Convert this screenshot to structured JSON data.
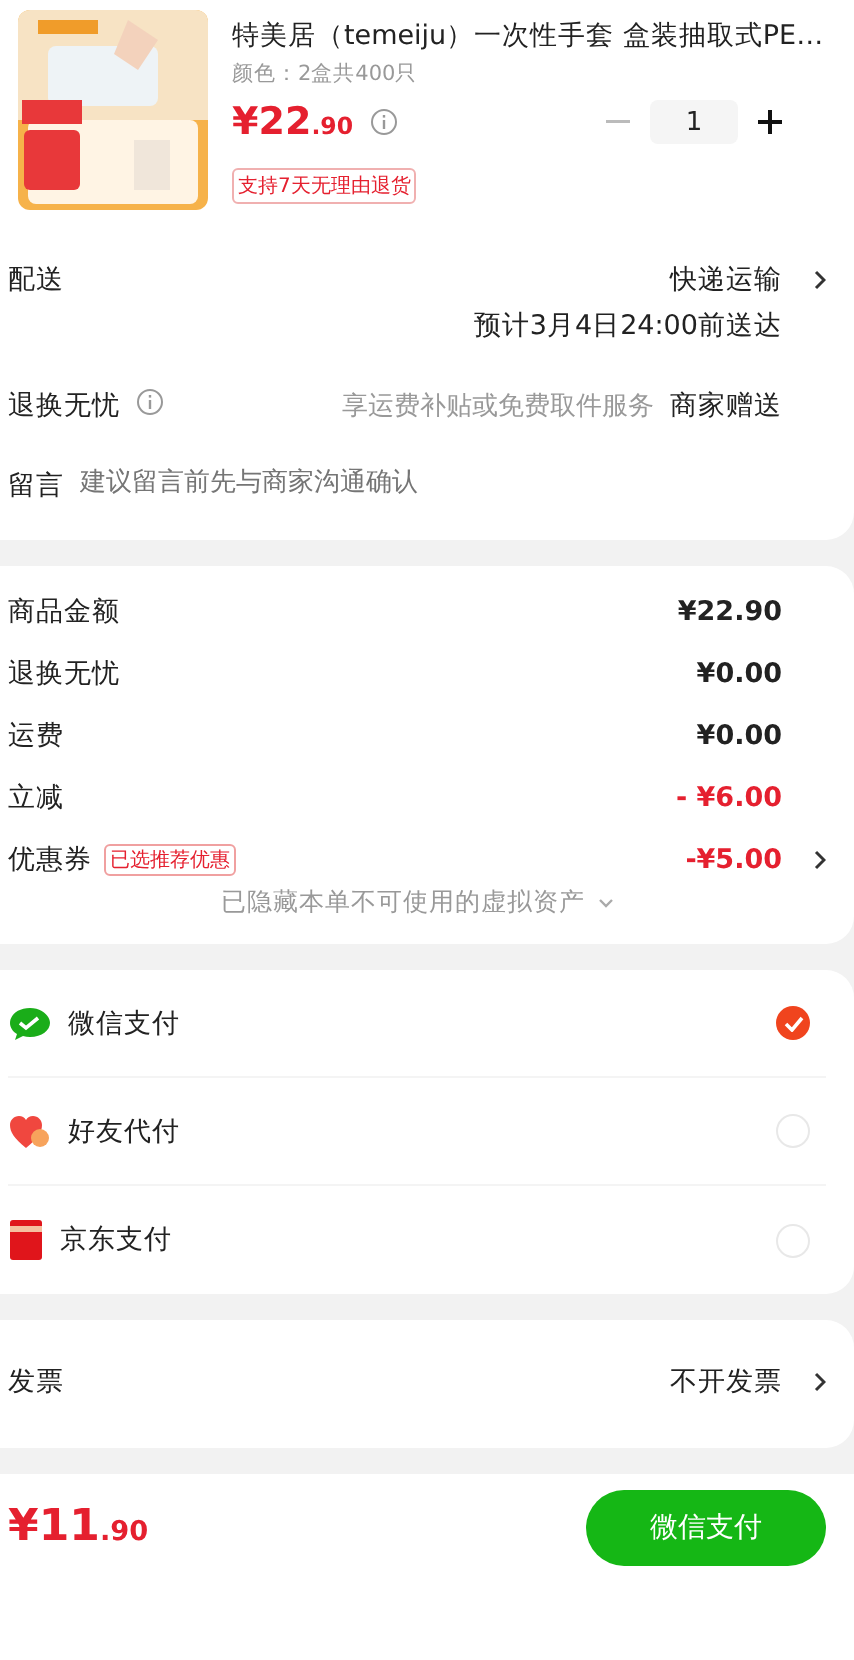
{
  "product": {
    "title": "特美居（temeiju）一次性手套 盒装抽取式PE…",
    "variant": "颜色：2盒共400只",
    "price": {
      "symbol": "¥",
      "integer": "22",
      "decimal": ".90"
    },
    "quantity": "1",
    "badge": "支持7天无理由退货"
  },
  "order_rows": [
    {
      "kind": "delivery",
      "label": "配送",
      "value": "快递运输",
      "note": "预计3月4日24:00前送达"
    },
    {
      "kind": "service",
      "label": "退换无忧",
      "hint": "享运费补贴或免费取件服务",
      "value": "商家赠送"
    },
    {
      "kind": "message",
      "label": "留言",
      "placeholder": "建议留言前先与商家沟通确认"
    }
  ],
  "summary": [
    {
      "label": "商品金额",
      "value": "¥22.90",
      "discount": false
    },
    {
      "label": "退换无忧",
      "value": "¥0.00",
      "discount": false
    },
    {
      "label": "运费",
      "value": "¥0.00",
      "discount": false
    },
    {
      "label": "立减",
      "value": "- ¥6.00",
      "discount": true
    },
    {
      "label": "优惠券",
      "tag": "已选推荐优惠",
      "value": "-¥5.00",
      "discount": true,
      "link": true
    }
  ],
  "hidden_assets": "已隐藏本单不可使用的虚拟资产",
  "payments": [
    {
      "kind": "wechat",
      "label": "微信支付",
      "selected": true
    },
    {
      "kind": "friend",
      "label": "好友代付",
      "selected": false
    },
    {
      "kind": "jd",
      "label": "京东支付",
      "selected": false
    }
  ],
  "invoice": {
    "label": "发票",
    "value": "不开发票"
  },
  "footer": {
    "total": {
      "symbol": "¥",
      "integer": "11",
      "decimal": ".90"
    },
    "pay_button": "微信支付"
  }
}
